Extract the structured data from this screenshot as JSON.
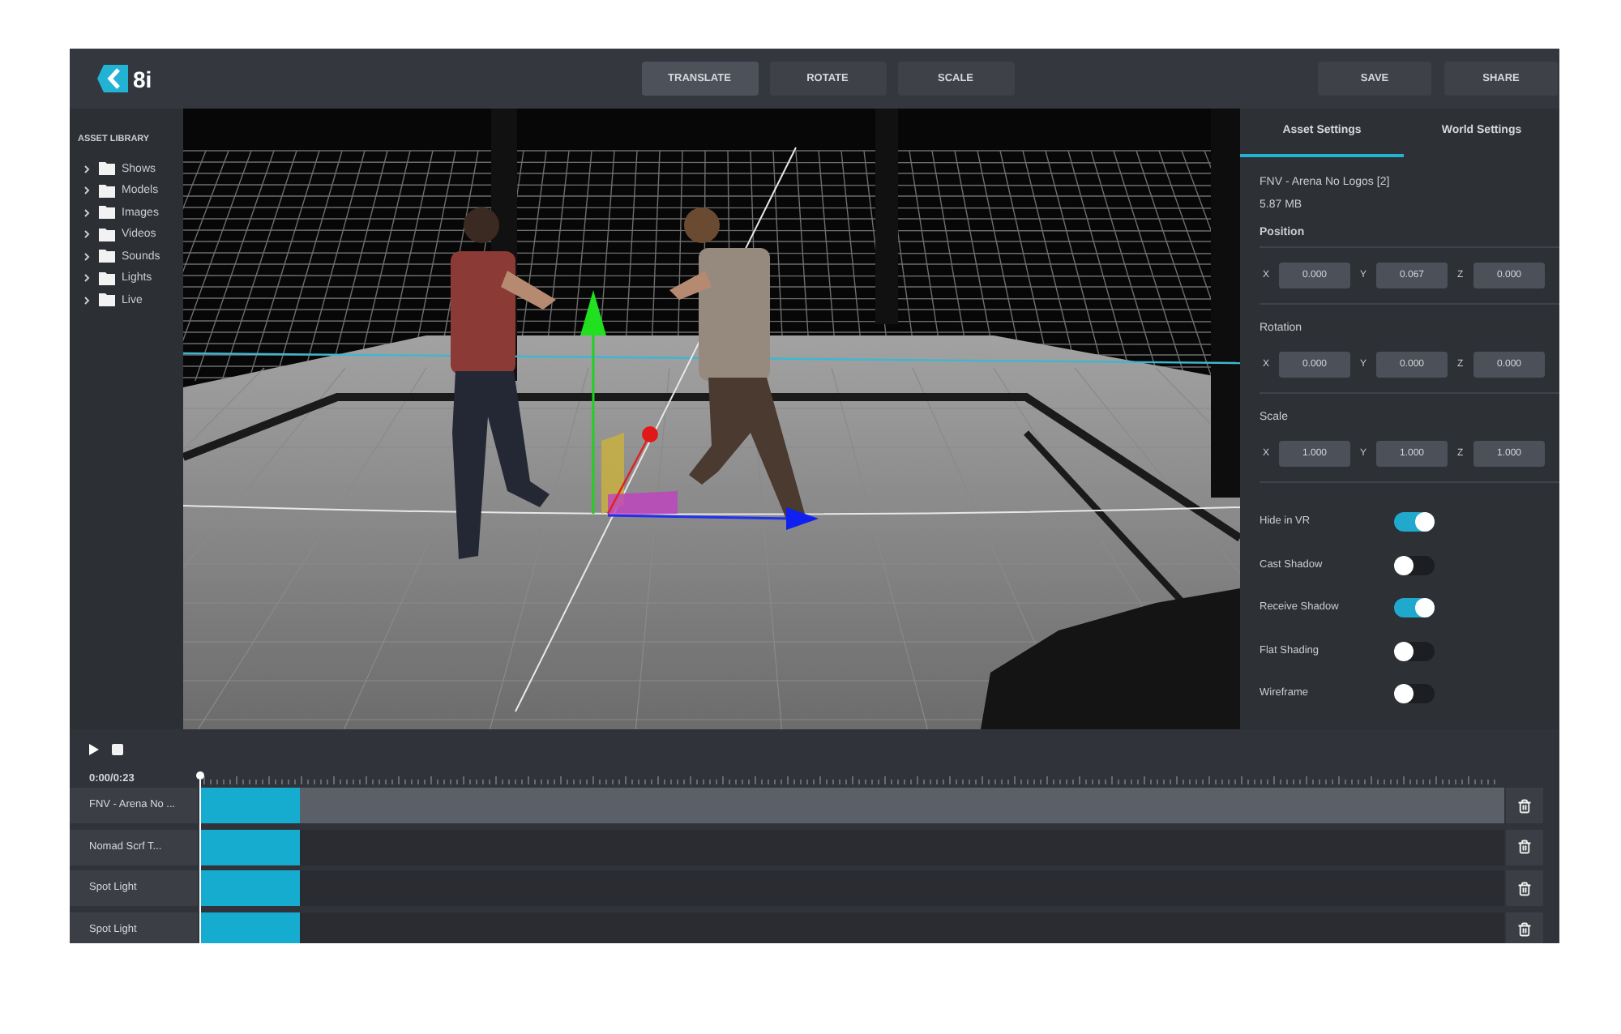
{
  "logo": {
    "text": "8i"
  },
  "toolbar": {
    "tools": [
      {
        "label": "TRANSLATE",
        "selected": true
      },
      {
        "label": "ROTATE",
        "selected": false
      },
      {
        "label": "SCALE",
        "selected": false
      }
    ],
    "actions": [
      {
        "label": "SAVE"
      },
      {
        "label": "SHARE"
      }
    ]
  },
  "asset_library": {
    "title": "ASSET LIBRARY",
    "items": [
      {
        "label": "Shows",
        "expanded": false
      },
      {
        "label": "Models",
        "expanded": false
      },
      {
        "label": "Images",
        "expanded": false
      },
      {
        "label": "Videos",
        "expanded": false
      },
      {
        "label": "Sounds",
        "expanded": false
      },
      {
        "label": "Lights",
        "expanded": false
      },
      {
        "label": "Live",
        "expanded": false
      }
    ]
  },
  "settings_panel": {
    "tabs": [
      {
        "label": "Asset Settings",
        "selected": true
      },
      {
        "label": "World Settings",
        "selected": false
      }
    ],
    "asset_name": "FNV - Arena No Logos [2]",
    "asset_size": "5.87 MB",
    "groups": [
      {
        "label": "Position",
        "fields": [
          {
            "axis": "X",
            "value": "0.000"
          },
          {
            "axis": "Y",
            "value": "0.067"
          },
          {
            "axis": "Z",
            "value": "0.000"
          }
        ]
      },
      {
        "label": "Rotation",
        "fields": [
          {
            "axis": "X",
            "value": "0.000"
          },
          {
            "axis": "Y",
            "value": "0.000"
          },
          {
            "axis": "Z",
            "value": "0.000"
          }
        ]
      },
      {
        "label": "Scale",
        "fields": [
          {
            "axis": "X",
            "value": "1.000"
          },
          {
            "axis": "Y",
            "value": "1.000"
          },
          {
            "axis": "Z",
            "value": "1.000"
          }
        ]
      }
    ],
    "toggles": [
      {
        "label": "Hide in VR",
        "on": true
      },
      {
        "label": "Cast Shadow",
        "on": false
      },
      {
        "label": "Receive Shadow",
        "on": true
      },
      {
        "label": "Flat Shading",
        "on": false
      },
      {
        "label": "Wireframe",
        "on": false
      }
    ]
  },
  "timeline": {
    "time": "0:00/0:23",
    "tracks": [
      {
        "label": "FNV - Arena No ...",
        "selected": true
      },
      {
        "label": "Nomad Scrf T...",
        "selected": false
      },
      {
        "label": "Spot Light",
        "selected": false
      },
      {
        "label": "Spot Light",
        "selected": false
      }
    ]
  }
}
